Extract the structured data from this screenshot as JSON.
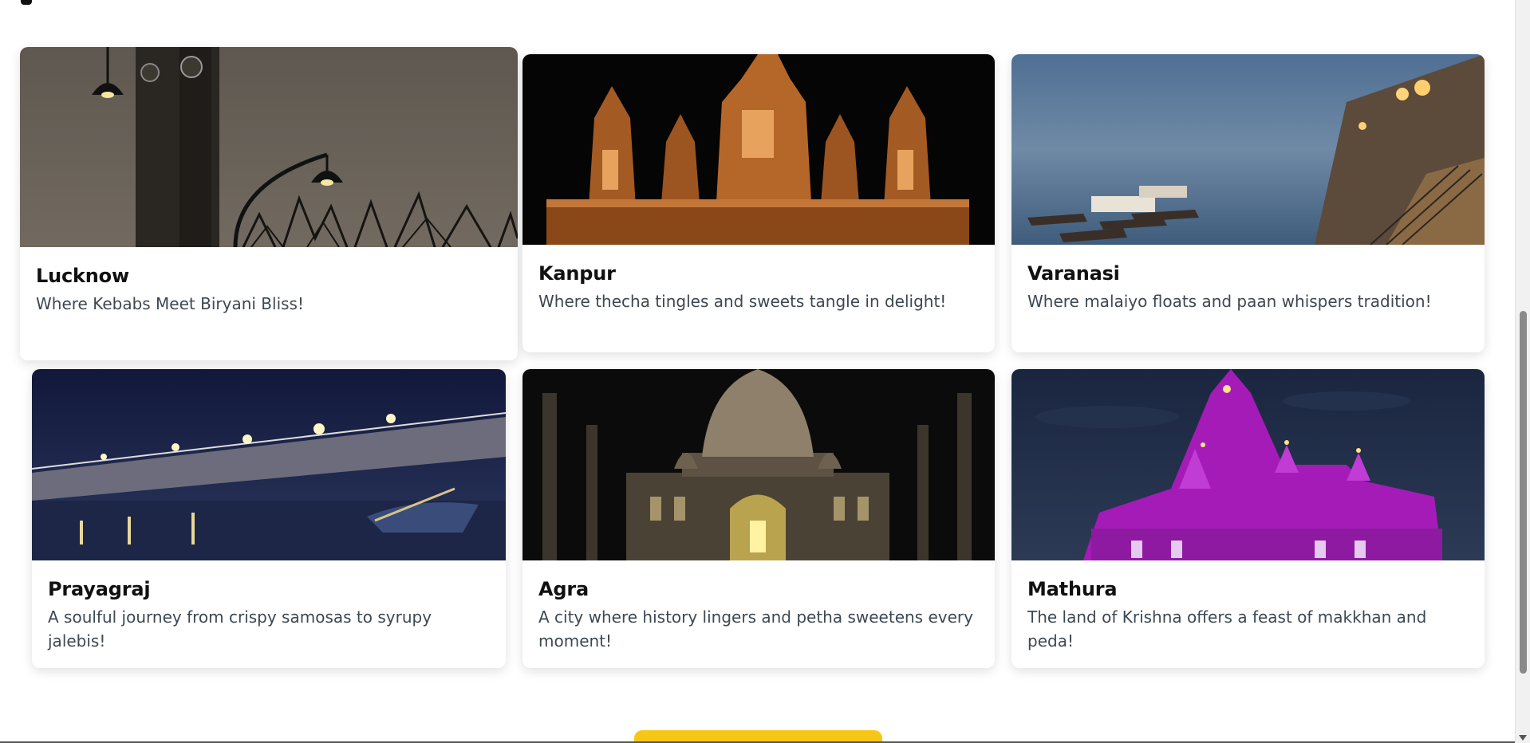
{
  "cards": [
    {
      "title": "Lucknow",
      "description": "Where Kebabs Meet Biryani Bliss!"
    },
    {
      "title": "Kanpur",
      "description": "Where thecha tingles and sweets tangle in delight!"
    },
    {
      "title": "Varanasi",
      "description": "Where malaiyo floats and paan whispers tradition!"
    },
    {
      "title": "Prayagraj",
      "description": "A soulful journey from crispy samosas to syrupy jalebis!"
    },
    {
      "title": "Agra",
      "description": "A city where history lingers and petha sweetens every moment!"
    },
    {
      "title": "Mathura",
      "description": "The land of Krishna offers a feast of makkhan and peda!"
    }
  ],
  "colors": {
    "accent": "#f6c715",
    "title_text": "#111111",
    "description_text": "#3d4852"
  },
  "icons": {
    "scroll_down": "chevron-down-icon"
  }
}
